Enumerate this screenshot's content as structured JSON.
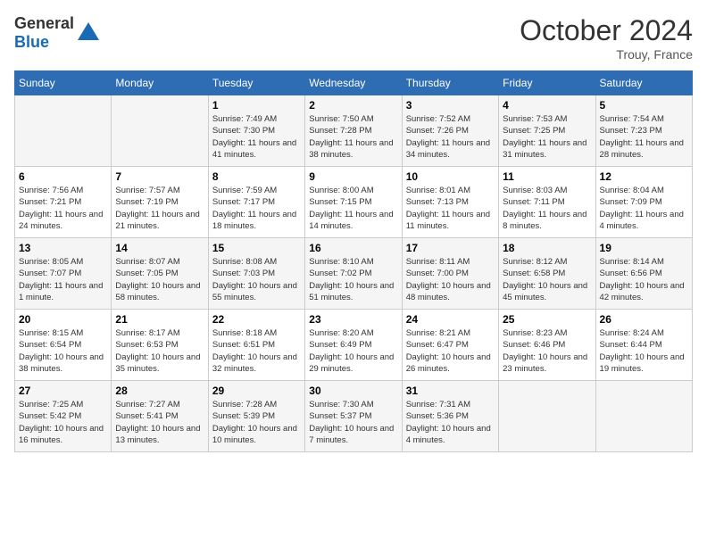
{
  "header": {
    "logo_general": "General",
    "logo_blue": "Blue",
    "title": "October 2024",
    "location": "Trouy, France"
  },
  "days_of_week": [
    "Sunday",
    "Monday",
    "Tuesday",
    "Wednesday",
    "Thursday",
    "Friday",
    "Saturday"
  ],
  "weeks": [
    [
      {
        "day": "",
        "sunrise": "",
        "sunset": "",
        "daylight": ""
      },
      {
        "day": "",
        "sunrise": "",
        "sunset": "",
        "daylight": ""
      },
      {
        "day": "1",
        "sunrise": "Sunrise: 7:49 AM",
        "sunset": "Sunset: 7:30 PM",
        "daylight": "Daylight: 11 hours and 41 minutes."
      },
      {
        "day": "2",
        "sunrise": "Sunrise: 7:50 AM",
        "sunset": "Sunset: 7:28 PM",
        "daylight": "Daylight: 11 hours and 38 minutes."
      },
      {
        "day": "3",
        "sunrise": "Sunrise: 7:52 AM",
        "sunset": "Sunset: 7:26 PM",
        "daylight": "Daylight: 11 hours and 34 minutes."
      },
      {
        "day": "4",
        "sunrise": "Sunrise: 7:53 AM",
        "sunset": "Sunset: 7:25 PM",
        "daylight": "Daylight: 11 hours and 31 minutes."
      },
      {
        "day": "5",
        "sunrise": "Sunrise: 7:54 AM",
        "sunset": "Sunset: 7:23 PM",
        "daylight": "Daylight: 11 hours and 28 minutes."
      }
    ],
    [
      {
        "day": "6",
        "sunrise": "Sunrise: 7:56 AM",
        "sunset": "Sunset: 7:21 PM",
        "daylight": "Daylight: 11 hours and 24 minutes."
      },
      {
        "day": "7",
        "sunrise": "Sunrise: 7:57 AM",
        "sunset": "Sunset: 7:19 PM",
        "daylight": "Daylight: 11 hours and 21 minutes."
      },
      {
        "day": "8",
        "sunrise": "Sunrise: 7:59 AM",
        "sunset": "Sunset: 7:17 PM",
        "daylight": "Daylight: 11 hours and 18 minutes."
      },
      {
        "day": "9",
        "sunrise": "Sunrise: 8:00 AM",
        "sunset": "Sunset: 7:15 PM",
        "daylight": "Daylight: 11 hours and 14 minutes."
      },
      {
        "day": "10",
        "sunrise": "Sunrise: 8:01 AM",
        "sunset": "Sunset: 7:13 PM",
        "daylight": "Daylight: 11 hours and 11 minutes."
      },
      {
        "day": "11",
        "sunrise": "Sunrise: 8:03 AM",
        "sunset": "Sunset: 7:11 PM",
        "daylight": "Daylight: 11 hours and 8 minutes."
      },
      {
        "day": "12",
        "sunrise": "Sunrise: 8:04 AM",
        "sunset": "Sunset: 7:09 PM",
        "daylight": "Daylight: 11 hours and 4 minutes."
      }
    ],
    [
      {
        "day": "13",
        "sunrise": "Sunrise: 8:05 AM",
        "sunset": "Sunset: 7:07 PM",
        "daylight": "Daylight: 11 hours and 1 minute."
      },
      {
        "day": "14",
        "sunrise": "Sunrise: 8:07 AM",
        "sunset": "Sunset: 7:05 PM",
        "daylight": "Daylight: 10 hours and 58 minutes."
      },
      {
        "day": "15",
        "sunrise": "Sunrise: 8:08 AM",
        "sunset": "Sunset: 7:03 PM",
        "daylight": "Daylight: 10 hours and 55 minutes."
      },
      {
        "day": "16",
        "sunrise": "Sunrise: 8:10 AM",
        "sunset": "Sunset: 7:02 PM",
        "daylight": "Daylight: 10 hours and 51 minutes."
      },
      {
        "day": "17",
        "sunrise": "Sunrise: 8:11 AM",
        "sunset": "Sunset: 7:00 PM",
        "daylight": "Daylight: 10 hours and 48 minutes."
      },
      {
        "day": "18",
        "sunrise": "Sunrise: 8:12 AM",
        "sunset": "Sunset: 6:58 PM",
        "daylight": "Daylight: 10 hours and 45 minutes."
      },
      {
        "day": "19",
        "sunrise": "Sunrise: 8:14 AM",
        "sunset": "Sunset: 6:56 PM",
        "daylight": "Daylight: 10 hours and 42 minutes."
      }
    ],
    [
      {
        "day": "20",
        "sunrise": "Sunrise: 8:15 AM",
        "sunset": "Sunset: 6:54 PM",
        "daylight": "Daylight: 10 hours and 38 minutes."
      },
      {
        "day": "21",
        "sunrise": "Sunrise: 8:17 AM",
        "sunset": "Sunset: 6:53 PM",
        "daylight": "Daylight: 10 hours and 35 minutes."
      },
      {
        "day": "22",
        "sunrise": "Sunrise: 8:18 AM",
        "sunset": "Sunset: 6:51 PM",
        "daylight": "Daylight: 10 hours and 32 minutes."
      },
      {
        "day": "23",
        "sunrise": "Sunrise: 8:20 AM",
        "sunset": "Sunset: 6:49 PM",
        "daylight": "Daylight: 10 hours and 29 minutes."
      },
      {
        "day": "24",
        "sunrise": "Sunrise: 8:21 AM",
        "sunset": "Sunset: 6:47 PM",
        "daylight": "Daylight: 10 hours and 26 minutes."
      },
      {
        "day": "25",
        "sunrise": "Sunrise: 8:23 AM",
        "sunset": "Sunset: 6:46 PM",
        "daylight": "Daylight: 10 hours and 23 minutes."
      },
      {
        "day": "26",
        "sunrise": "Sunrise: 8:24 AM",
        "sunset": "Sunset: 6:44 PM",
        "daylight": "Daylight: 10 hours and 19 minutes."
      }
    ],
    [
      {
        "day": "27",
        "sunrise": "Sunrise: 7:25 AM",
        "sunset": "Sunset: 5:42 PM",
        "daylight": "Daylight: 10 hours and 16 minutes."
      },
      {
        "day": "28",
        "sunrise": "Sunrise: 7:27 AM",
        "sunset": "Sunset: 5:41 PM",
        "daylight": "Daylight: 10 hours and 13 minutes."
      },
      {
        "day": "29",
        "sunrise": "Sunrise: 7:28 AM",
        "sunset": "Sunset: 5:39 PM",
        "daylight": "Daylight: 10 hours and 10 minutes."
      },
      {
        "day": "30",
        "sunrise": "Sunrise: 7:30 AM",
        "sunset": "Sunset: 5:37 PM",
        "daylight": "Daylight: 10 hours and 7 minutes."
      },
      {
        "day": "31",
        "sunrise": "Sunrise: 7:31 AM",
        "sunset": "Sunset: 5:36 PM",
        "daylight": "Daylight: 10 hours and 4 minutes."
      },
      {
        "day": "",
        "sunrise": "",
        "sunset": "",
        "daylight": ""
      },
      {
        "day": "",
        "sunrise": "",
        "sunset": "",
        "daylight": ""
      }
    ]
  ]
}
